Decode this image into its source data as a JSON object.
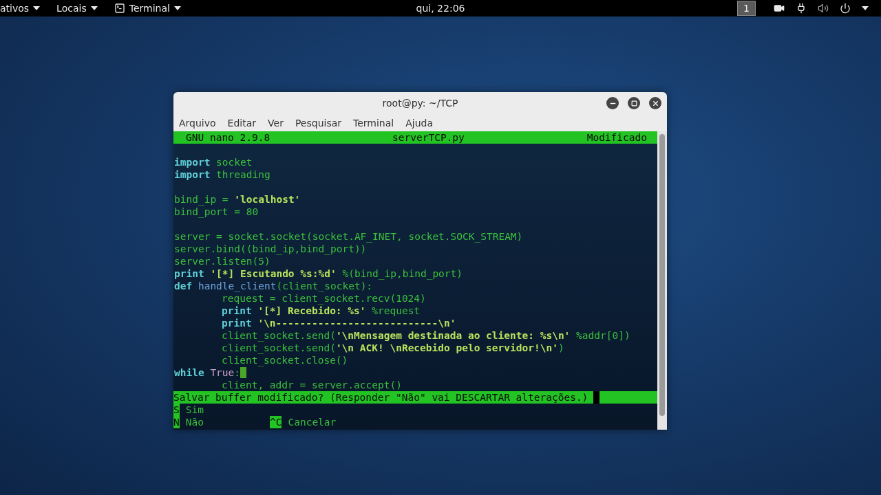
{
  "top_bar": {
    "menus": [
      {
        "label": "ativos",
        "kind": "menu"
      },
      {
        "label": "Locais",
        "kind": "menu"
      },
      {
        "label": "Terminal",
        "kind": "app"
      }
    ],
    "clock": "qui, 22:06",
    "workspace": "1"
  },
  "window": {
    "title": "root@py: ~/TCP",
    "menu": [
      "Arquivo",
      "Editar",
      "Ver",
      "Pesquisar",
      "Terminal",
      "Ajuda"
    ]
  },
  "nano": {
    "version": "GNU nano 2.9.8",
    "filename": "serverTCP.py",
    "status": "Modificado"
  },
  "lines": [
    {
      "blank_before": true,
      "segments": [
        {
          "kind": "keyword",
          "text": "import"
        },
        {
          "kind": "plain",
          "text": " socket"
        }
      ]
    },
    {
      "segments": [
        {
          "kind": "keyword",
          "text": "import"
        },
        {
          "kind": "plain",
          "text": " threading"
        }
      ]
    },
    {
      "blank_before": true,
      "segments": [
        {
          "kind": "plain",
          "text": "bind_ip = "
        },
        {
          "kind": "string",
          "text": "'localhost'"
        }
      ]
    },
    {
      "segments": [
        {
          "kind": "plain",
          "text": "bind_port = 80"
        }
      ]
    },
    {
      "blank_before": true,
      "segments": [
        {
          "kind": "plain",
          "text": "server = socket.socket(socket.AF_INET, socket.SOCK_STREAM)"
        }
      ]
    },
    {
      "segments": [
        {
          "kind": "plain",
          "text": "server.bind((bind_ip,bind_port))"
        }
      ]
    },
    {
      "segments": [
        {
          "kind": "plain",
          "text": "server.listen(5)"
        }
      ]
    },
    {
      "segments": [
        {
          "kind": "keyword",
          "text": "print"
        },
        {
          "kind": "string",
          "text": " '[*] Escutando %s:%d'"
        },
        {
          "kind": "plain",
          "text": " %(bind_ip,bind_port)"
        }
      ]
    },
    {
      "segments": [
        {
          "kind": "keyword",
          "text": "def"
        },
        {
          "kind": "function",
          "text": " handle_client"
        },
        {
          "kind": "plain",
          "text": "(client_socket):"
        }
      ]
    },
    {
      "indented": true,
      "segments": [
        {
          "kind": "plain",
          "text": "request = client_socket.recv(1024)"
        }
      ]
    },
    {
      "indented": true,
      "segments": [
        {
          "kind": "keyword",
          "text": "print"
        },
        {
          "kind": "string",
          "text": " '[*] Recebido: %s'"
        },
        {
          "kind": "plain",
          "text": " %request"
        }
      ]
    },
    {
      "indented": true,
      "segments": [
        {
          "kind": "keyword",
          "text": "print"
        },
        {
          "kind": "string",
          "text": " '\\n---------------------------\\n'"
        }
      ]
    },
    {
      "indented": true,
      "segments": [
        {
          "kind": "plain",
          "text": "client_socket.send("
        },
        {
          "kind": "string",
          "text": "'\\nMensagem destinada ao cliente: %s\\n'"
        },
        {
          "kind": "plain",
          "text": " %addr[0])"
        }
      ]
    },
    {
      "indented": true,
      "segments": [
        {
          "kind": "plain",
          "text": "client_socket.send("
        },
        {
          "kind": "string",
          "text": "'\\n ACK! \\nRecebido pelo servidor!\\n'"
        },
        {
          "kind": "plain",
          "text": ")"
        }
      ]
    },
    {
      "indented": true,
      "segments": [
        {
          "kind": "plain",
          "text": "client_socket.close()"
        }
      ]
    },
    {
      "cursor": true,
      "segments": [
        {
          "kind": "keyword",
          "text": "while"
        },
        {
          "kind": "constant",
          "text": " True"
        },
        {
          "kind": "plain",
          "text": ":"
        }
      ]
    },
    {
      "indented": true,
      "segments": [
        {
          "kind": "plain",
          "text": "client, addr = server.accept()"
        }
      ]
    }
  ],
  "prompt": {
    "question": "Salvar buffer modificado? (Responder \"Não\" vai DESCARTAR alterações.)",
    "rows": [
      [
        {
          "key": "S",
          "label": "Sim"
        }
      ],
      [
        {
          "key": "N",
          "label": "Não"
        },
        {
          "key": "^C",
          "label": "Cancelar"
        }
      ]
    ]
  }
}
